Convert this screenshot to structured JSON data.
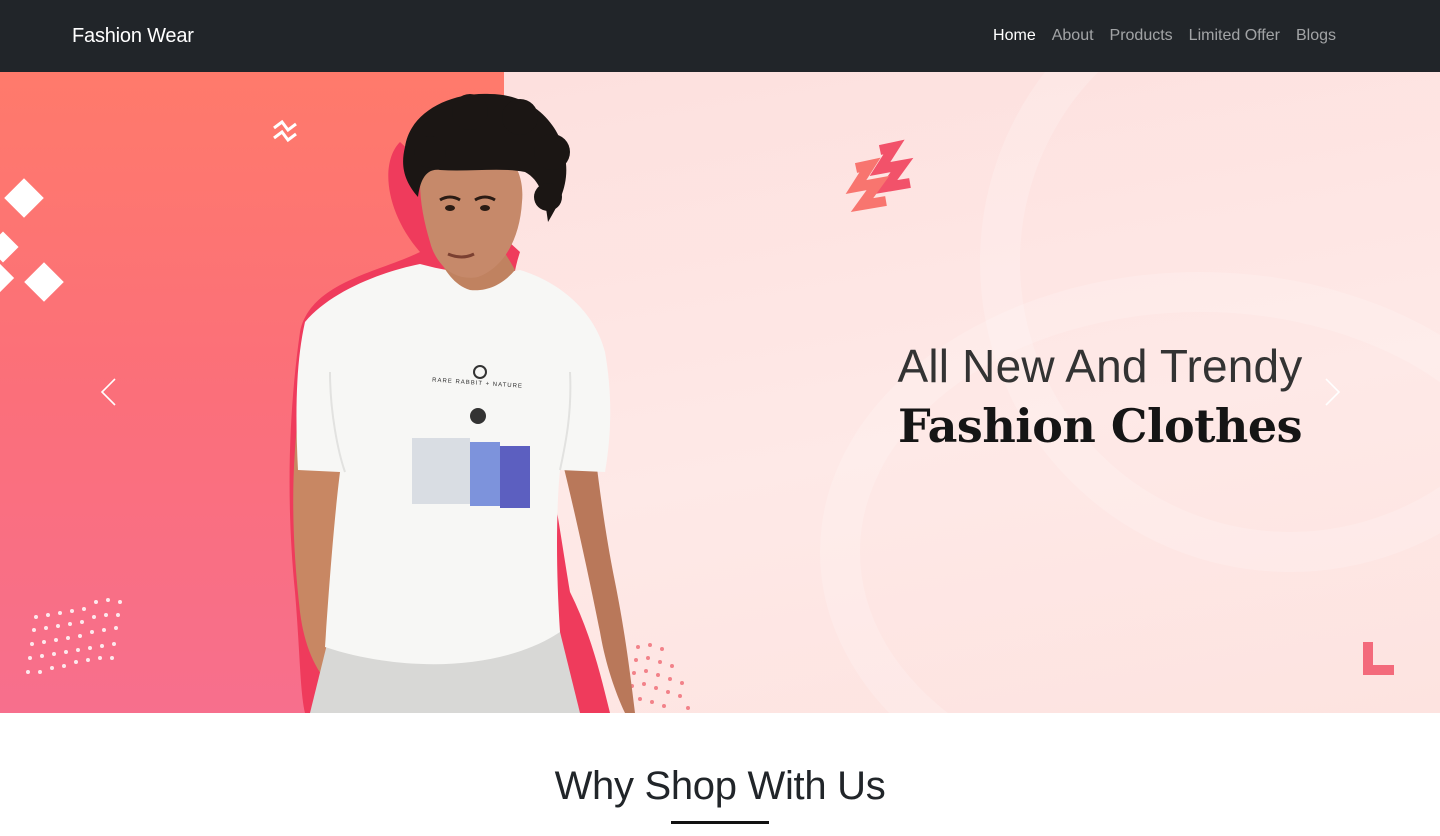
{
  "navbar": {
    "brand": "Fashion Wear",
    "links": [
      "Home",
      "About",
      "Products",
      "Limited Offer",
      "Blogs"
    ],
    "active": "Home"
  },
  "hero": {
    "headline_line1": "All New And Trendy",
    "headline_line2": "Fashion Clothes",
    "shirt_print_text": "RARE RABBIT + NATURE",
    "prev_label": "Previous",
    "next_label": "Next"
  },
  "section": {
    "title": "Why Shop With Us"
  },
  "colors": {
    "navbar_bg": "#212529",
    "hero_left": "#fb6f7a",
    "hero_right": "#fde4e2",
    "accent": "#f0515f"
  },
  "icons": [
    "chevron-left-icon",
    "chevron-right-icon"
  ]
}
